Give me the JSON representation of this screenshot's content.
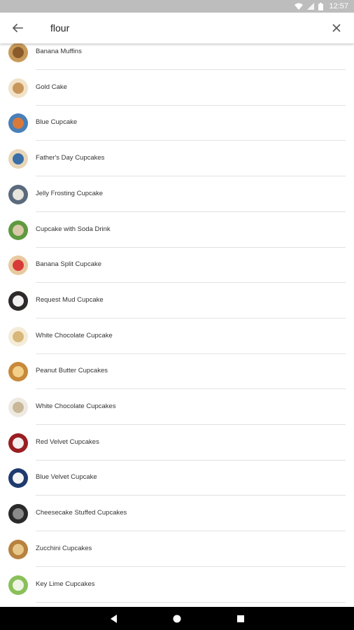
{
  "status_bar": {
    "time": "12:57",
    "icons": [
      "wifi-icon",
      "signal-icon",
      "battery-icon"
    ]
  },
  "search": {
    "query": "flour",
    "back_icon": "arrow-left-icon",
    "clear_icon": "close-icon"
  },
  "results": [
    {
      "label": "Banana Muffins",
      "colors": [
        "#c89a5a",
        "#8a5a2a"
      ]
    },
    {
      "label": "Gold Cake",
      "colors": [
        "#f1e2c8",
        "#c8955a"
      ]
    },
    {
      "label": "Blue Cupcake",
      "colors": [
        "#4a7fb8",
        "#d97a3a"
      ]
    },
    {
      "label": "Father's Day Cupcakes",
      "colors": [
        "#e8d6b8",
        "#3a6fa8"
      ]
    },
    {
      "label": "Jelly Frosting Cupcake",
      "colors": [
        "#5b6b7d",
        "#e8e4de"
      ]
    },
    {
      "label": "Cupcake with Soda Drink",
      "colors": [
        "#5e9a3e",
        "#d9c9a8"
      ]
    },
    {
      "label": "Banana Split Cupcake",
      "colors": [
        "#e8c9a0",
        "#d83a3a"
      ]
    },
    {
      "label": "Request Mud Cupcake",
      "colors": [
        "#2e2a2a",
        "#f0f0f0"
      ]
    },
    {
      "label": "White Chocolate Cupcake",
      "colors": [
        "#f4ecd8",
        "#d8b878"
      ]
    },
    {
      "label": "Peanut Butter Cupcakes",
      "colors": [
        "#c88a3a",
        "#f2d08a"
      ]
    },
    {
      "label": "White Chocolate Cupcakes",
      "colors": [
        "#eeeae2",
        "#c8b898"
      ]
    },
    {
      "label": "Red Velvet Cupcakes",
      "colors": [
        "#9a1e22",
        "#f4eeee"
      ]
    },
    {
      "label": "Blue Velvet Cupcake",
      "colors": [
        "#1e3a6e",
        "#f4f4f4"
      ]
    },
    {
      "label": "Cheesecake Stuffed Cupcakes",
      "colors": [
        "#2a2a2a",
        "#8a8a8a"
      ]
    },
    {
      "label": "Zucchini Cupcakes",
      "colors": [
        "#b8823e",
        "#e8c88a"
      ]
    },
    {
      "label": "Key Lime Cupcakes",
      "colors": [
        "#8ac05a",
        "#eef4e2"
      ]
    }
  ],
  "nav": {
    "back_icon": "nav-back-icon",
    "home_icon": "nav-home-icon",
    "recents_icon": "nav-recents-icon"
  }
}
